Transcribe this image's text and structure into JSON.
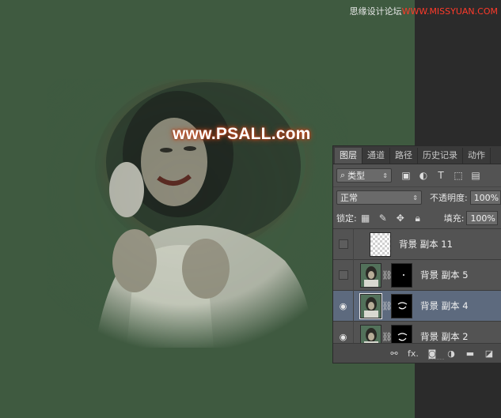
{
  "watermark_top": {
    "prefix": "思缘设计论坛",
    "domain": "WWW.MISSYUAN.COM"
  },
  "photo_watermark": "www.PSALL.com",
  "panel": {
    "tabs": [
      "图层",
      "通道",
      "路径",
      "历史记录",
      "动作"
    ],
    "filter_kind": "类型",
    "blend_mode": "正常",
    "opacity_label": "不透明度:",
    "opacity_value": "100%",
    "lock_label": "锁定:",
    "fill_label": "填充:",
    "fill_value": "100%",
    "layers": [
      {
        "name": "背景 副本 11",
        "visible": false,
        "selected": false
      },
      {
        "name": "背景 副本 5",
        "visible": false,
        "selected": false
      },
      {
        "name": "背景 副本 4",
        "visible": true,
        "selected": true
      },
      {
        "name": "背景 副本 2",
        "visible": true,
        "selected": false
      }
    ],
    "footer_fx": "fx."
  },
  "colors": {
    "canvas_bg": "#3f5a40",
    "panel_bg": "#535353",
    "selected_layer": "#5d6a7e",
    "watermark_glow": "#c24a1f"
  }
}
